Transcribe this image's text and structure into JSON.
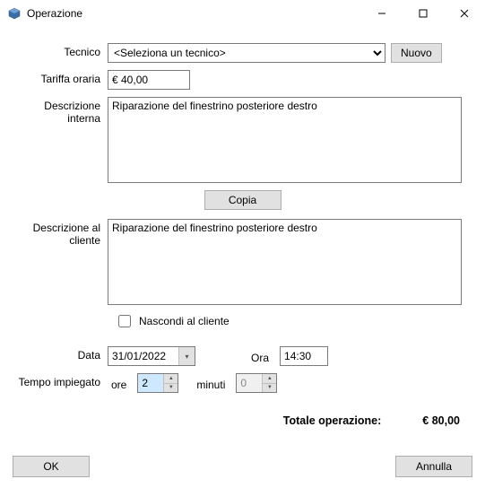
{
  "window": {
    "title": "Operazione"
  },
  "labels": {
    "tecnico": "Tecnico",
    "tariffa": "Tariffa oraria",
    "descInterna": "Descrizione interna",
    "descCliente": "Descrizione al cliente",
    "nascondi": "Nascondi al cliente",
    "data": "Data",
    "ora": "Ora",
    "tempo": "Tempo impiegato",
    "oreUnit": "ore",
    "minutiUnit": "minuti",
    "totale": "Totale operazione:"
  },
  "buttons": {
    "nuovo": "Nuovo",
    "copia": "Copia",
    "ok": "OK",
    "annulla": "Annulla"
  },
  "values": {
    "tecnicoPlaceholder": "<Seleziona un tecnico>",
    "tariffa": "€ 40,00",
    "descInterna": "Riparazione del finestrino posteriore destro",
    "descCliente": "Riparazione del finestrino posteriore destro",
    "nascondiChecked": false,
    "data": "31/01/2022",
    "ora": "14:30",
    "ore": "2",
    "minuti": "0",
    "totale": "€ 80,00"
  }
}
